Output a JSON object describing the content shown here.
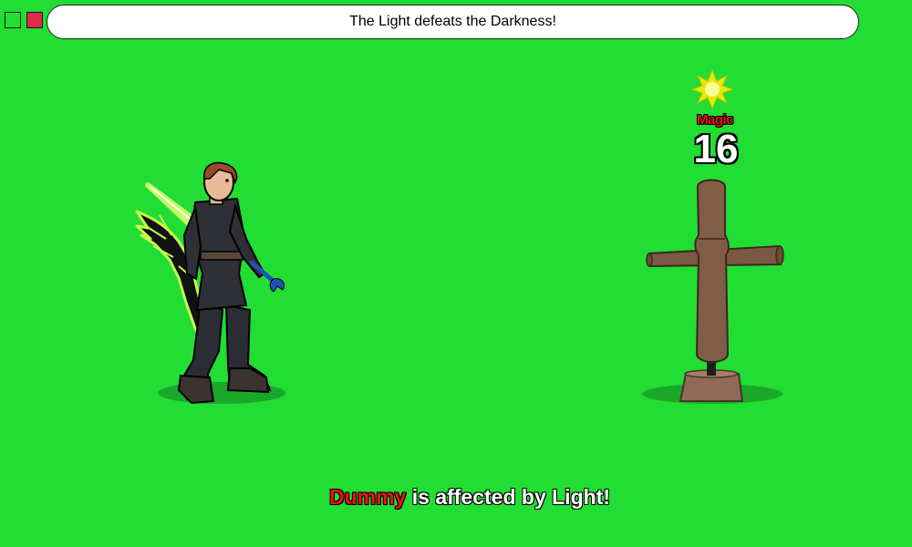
{
  "window": {
    "buttons": [
      {
        "name": "green",
        "color": "#22dd33"
      },
      {
        "name": "red",
        "color": "#e0294d"
      }
    ]
  },
  "banner": {
    "text": "The Light defeats the Darkness!"
  },
  "damage_popup": {
    "type_label": "Magic",
    "value": "16",
    "icon": "star-burst-icon"
  },
  "combat_message": {
    "target": "Dummy",
    "rest": " is affected by Light!"
  },
  "colors": {
    "background": "#22dd33",
    "damage_label": "#ee1111",
    "target_name": "#ee1111"
  }
}
